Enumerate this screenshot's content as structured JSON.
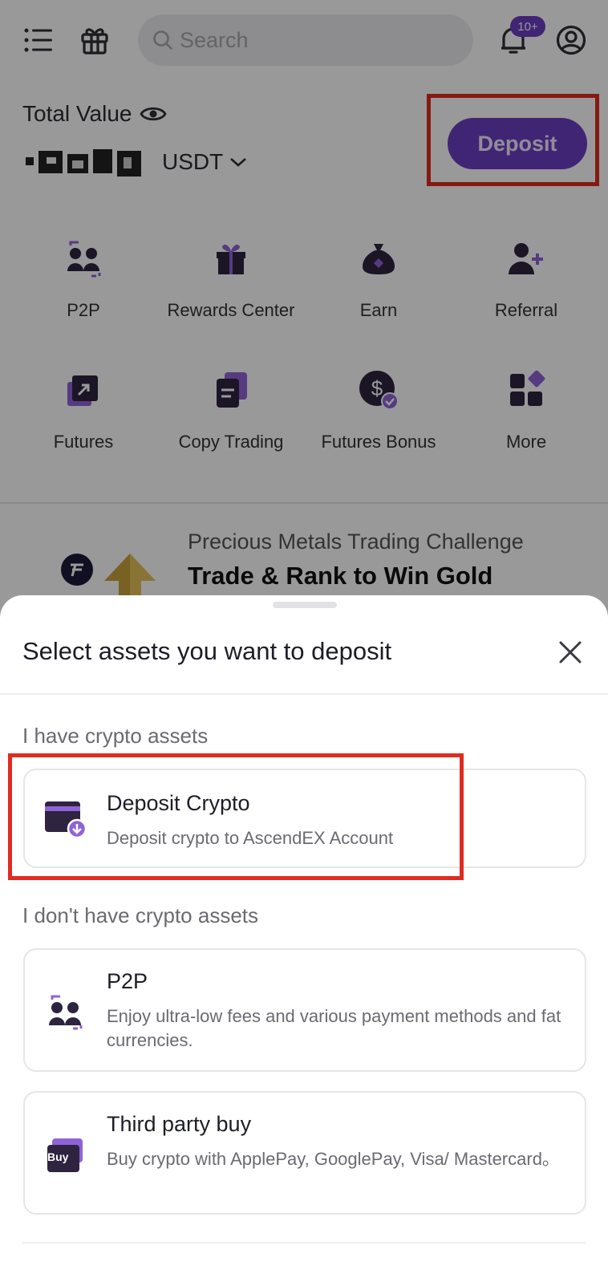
{
  "topbar": {
    "search_placeholder": "Search",
    "notification_badge": "10+"
  },
  "account": {
    "total_value_label": "Total Value",
    "currency": "USDT",
    "deposit_label": "Deposit"
  },
  "shortcuts": [
    {
      "label": "P2P",
      "icon": "p2p-icon"
    },
    {
      "label": "Rewards Center",
      "icon": "gift-box-icon"
    },
    {
      "label": "Earn",
      "icon": "money-bag-icon"
    },
    {
      "label": "Referral",
      "icon": "add-user-icon"
    },
    {
      "label": "Futures",
      "icon": "futures-chart-icon"
    },
    {
      "label": "Copy Trading",
      "icon": "copy-trading-icon"
    },
    {
      "label": "Futures Bonus",
      "icon": "dollar-coin-icon"
    },
    {
      "label": "More",
      "icon": "grid-more-icon"
    }
  ],
  "promo": {
    "subtitle": "Precious Metals Trading Challenge",
    "title": "Trade & Rank to Win Gold"
  },
  "sheet": {
    "title": "Select assets you want to deposit",
    "section_have": "I have crypto assets",
    "section_dont_have": "I don't have crypto assets",
    "options": [
      {
        "title": "Deposit Crypto",
        "desc": "Deposit crypto to AscendEX Account",
        "icon": "wallet-download-icon"
      },
      {
        "title": "P2P",
        "desc": "Enjoy ultra-low fees and various payment methods and fat currencies.",
        "icon": "p2p-icon"
      },
      {
        "title": "Third party buy",
        "desc": "Buy crypto with ApplePay, GooglePay, Visa/ Mastercard。",
        "icon": "buy-card-icon",
        "icon_text": "Buy"
      }
    ]
  },
  "colors": {
    "accent": "#6d3ec4",
    "highlight": "#e02b1f",
    "icon_dark": "#2e2440"
  }
}
